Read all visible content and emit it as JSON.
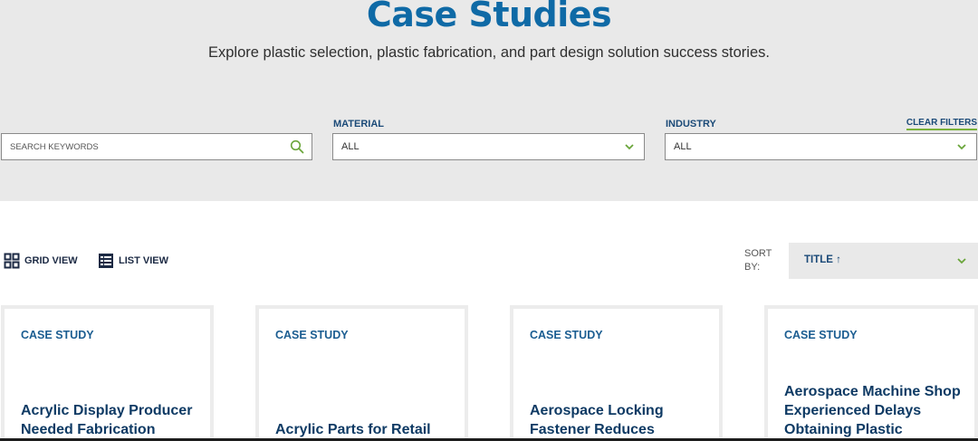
{
  "header": {
    "title": "Case Studies",
    "subtitle": "Explore plastic selection, plastic fabrication, and part design solution success stories."
  },
  "filters": {
    "search_placeholder": "SEARCH KEYWORDS",
    "material_label": "MATERIAL",
    "material_value": "ALL",
    "industry_label": "INDUSTRY",
    "industry_value": "ALL",
    "clear_label": "CLEAR FILTERS"
  },
  "toolbar": {
    "grid_view_label": "GRID VIEW",
    "list_view_label": "LIST VIEW",
    "sort_label_line1": "SORT",
    "sort_label_line2": "BY:",
    "sort_value": "TITLE ↑"
  },
  "cards": [
    {
      "kicker": "CASE STUDY",
      "title": "Acrylic Display Producer Needed Fabrication"
    },
    {
      "kicker": "CASE STUDY",
      "title": "Acrylic Parts for Retail"
    },
    {
      "kicker": "CASE STUDY",
      "title": "Aerospace Locking Fastener Reduces"
    },
    {
      "kicker": "CASE STUDY",
      "title": "Aerospace Machine Shop Experienced Delays Obtaining Plastic"
    }
  ],
  "colors": {
    "brand_blue": "#0f6aa6",
    "navy": "#1b4a78",
    "accent_green": "#7ab23a",
    "hero_bg": "#e9e9e9"
  },
  "icons": {
    "search": "search-icon",
    "dropdown": "chevron-down-icon",
    "grid": "grid-view-icon",
    "list": "list-view-icon"
  }
}
